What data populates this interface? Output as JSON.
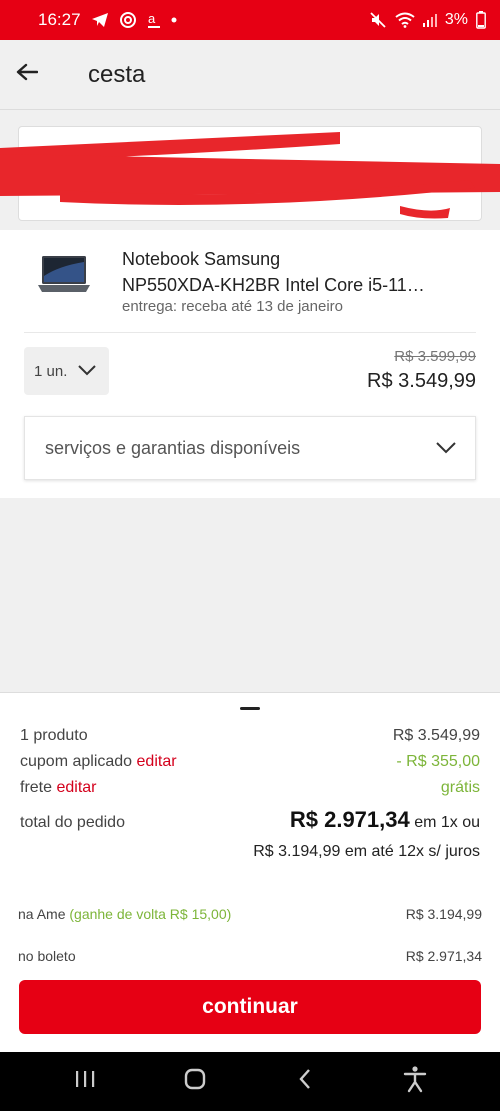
{
  "status_bar": {
    "time": "16:27",
    "battery": "3%",
    "left_icons": [
      "telegram-icon",
      "cast-icon",
      "amazon-icon",
      "dot-icon"
    ],
    "right_icons": [
      "mute-icon",
      "wifi-icon",
      "signal-icon",
      "battery-icon"
    ],
    "color": "#e60014"
  },
  "header": {
    "title": "cesta",
    "back_icon": "back-arrow-icon"
  },
  "cart_item": {
    "name_line1": "Notebook Samsung",
    "name_line2": "NP550XDA-KH2BR Intel Core i5-11…",
    "delivery": "entrega: receba até 13 de janeiro",
    "quantity": "1 un.",
    "old_price": "R$ 3.599,99",
    "price": "R$ 3.549,99",
    "services_label": "serviços e garantias disponíveis"
  },
  "summary": {
    "products_label": "1 produto",
    "products_value": "R$ 3.549,99",
    "coupon_label": "cupom aplicado",
    "coupon_edit": "editar",
    "coupon_value": "- R$ 355,00",
    "shipping_label": "frete",
    "shipping_edit": "editar",
    "shipping_value": "grátis",
    "total_label": "total do pedido",
    "total_value": "R$ 2.971,34",
    "total_suffix": "em 1x ou",
    "installments": "R$ 3.194,99 em até 12x s/ juros",
    "ame_label": "na Ame",
    "ame_cashback": "(ganhe de volta R$ 15,00)",
    "ame_value": "R$ 3.194,99",
    "boleto_label": "no boleto",
    "boleto_value": "R$ 2.971,34",
    "continue_label": "continuar"
  },
  "nav_bar": {
    "buttons": [
      "recent-apps-icon",
      "home-icon",
      "back-icon",
      "accessibility-icon"
    ]
  },
  "colors": {
    "brand_red": "#e60014",
    "edit_red": "#d4001c",
    "discount_green": "#7db53a"
  }
}
